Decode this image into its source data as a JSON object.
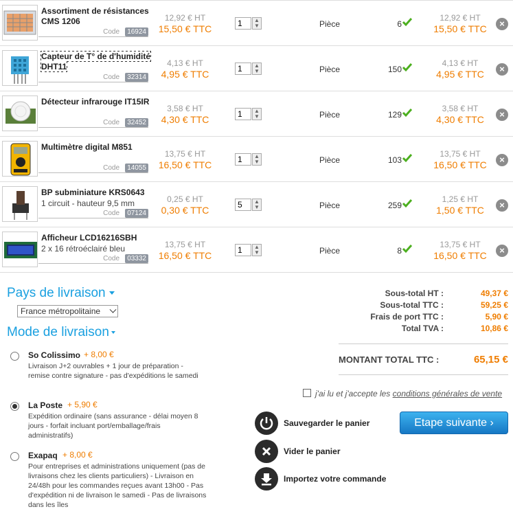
{
  "cart": {
    "code_label": "Code",
    "items": [
      {
        "name": "Assortiment de résistances CMS 1206",
        "desc": "",
        "code": "16924",
        "price_ht": "12,92 € HT",
        "price_ttc": "15,50 € TTC",
        "qty": "1",
        "unit": "Pièce",
        "stock": "6",
        "total_ht": "12,92 € HT",
        "total_ttc": "15,50 € TTC"
      },
      {
        "name": "Capteur de T° de d'humidité DHT11",
        "desc": "",
        "code": "32314",
        "price_ht": "4,13 € HT",
        "price_ttc": "4,95 € TTC",
        "qty": "1",
        "unit": "Pièce",
        "stock": "150",
        "total_ht": "4,13 € HT",
        "total_ttc": "4,95 € TTC"
      },
      {
        "name": "Détecteur infrarouge IT15IR",
        "desc": "",
        "code": "32452",
        "price_ht": "3,58 € HT",
        "price_ttc": "4,30 € TTC",
        "qty": "1",
        "unit": "Pièce",
        "stock": "129",
        "total_ht": "3,58 € HT",
        "total_ttc": "4,30 € TTC"
      },
      {
        "name": "Multimètre digital M851",
        "desc": "",
        "code": "14055",
        "price_ht": "13,75 € HT",
        "price_ttc": "16,50 € TTC",
        "qty": "1",
        "unit": "Pièce",
        "stock": "103",
        "total_ht": "13,75 € HT",
        "total_ttc": "16,50 € TTC"
      },
      {
        "name": "BP subminiature KRS0643",
        "desc": "1 circuit - hauteur 9,5 mm",
        "code": "07124",
        "price_ht": "0,25 € HT",
        "price_ttc": "0,30 € TTC",
        "qty": "5",
        "unit": "Pièce",
        "stock": "259",
        "total_ht": "1,25 € HT",
        "total_ttc": "1,50 € TTC"
      },
      {
        "name": "Afficheur LCD16216SBH",
        "desc": "2 x 16 rétroéclairé bleu",
        "code": "03332",
        "price_ht": "13,75 € HT",
        "price_ttc": "16,50 € TTC",
        "qty": "1",
        "unit": "Pièce",
        "stock": "8",
        "total_ht": "13,75 € HT",
        "total_ttc": "16,50 € TTC"
      }
    ]
  },
  "delivery": {
    "country_title": "Pays de livraison",
    "country_selected": "France métropolitaine",
    "mode_title": "Mode de livraison",
    "options": [
      {
        "name": "So Colissimo",
        "price": "+ 8,00 €",
        "selected": false,
        "desc": "Livraison J+2 ouvrables + 1 jour de préparation - remise contre signature - pas d'expéditions le samedi"
      },
      {
        "name": "La Poste",
        "price": "+ 5,90 €",
        "selected": true,
        "desc": "Expédition ordinaire (sans assurance - délai moyen 8 jours - forfait incluant port/emballage/frais administratifs)"
      },
      {
        "name": "Exapaq",
        "price": "+ 8,00 €",
        "selected": false,
        "desc": "Pour entreprises et administrations uniquement (pas de livraisons chez les clients particuliers) - Livraison en 24/48h pour les commandes reçues avant 13h00 - Pas d'expédition ni de livraison le samedi - Pas de livraisons dans les îles"
      }
    ]
  },
  "totals": {
    "subtotal_ht_label": "Sous-total HT :",
    "subtotal_ht": "49,37 €",
    "subtotal_ttc_label": "Sous-total TTC :",
    "subtotal_ttc": "59,25 €",
    "shipping_label": "Frais de port TTC :",
    "shipping": "5,90 €",
    "vat_label": "Total TVA :",
    "vat": "10,86 €",
    "grand_label": "MONTANT TOTAL TTC :",
    "grand": "65,15 €"
  },
  "terms": {
    "prefix": "j'ai lu et j'accepte les ",
    "link": "conditions générales de vente"
  },
  "actions": {
    "save": "Sauvegarder le panier",
    "empty": "Vider le panier",
    "import": "Importez votre commande",
    "next": "Etape suivante ›"
  }
}
